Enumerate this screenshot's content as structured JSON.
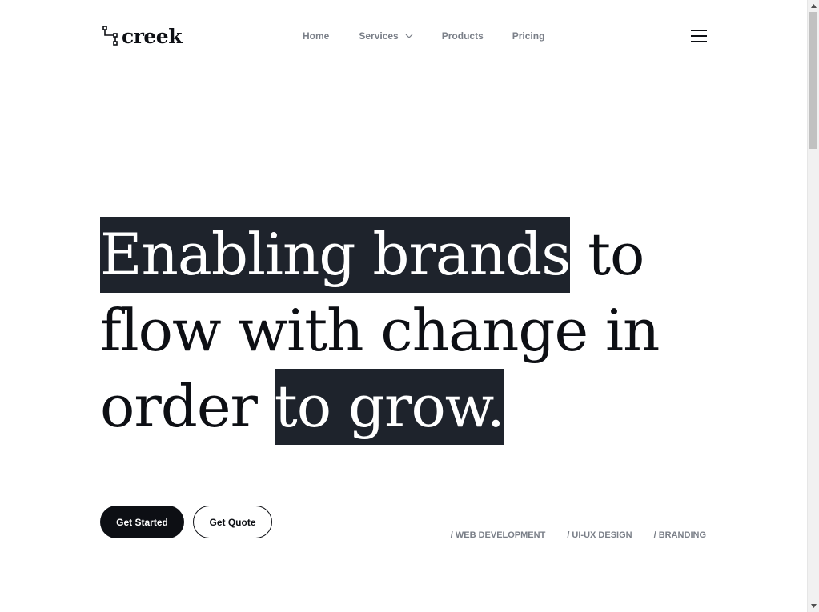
{
  "brand": {
    "name": "creek",
    "icon": "flow-nodes-icon"
  },
  "nav": {
    "items": [
      {
        "label": "Home"
      },
      {
        "label": "Services",
        "has_dropdown": true
      },
      {
        "label": "Products"
      },
      {
        "label": "Pricing"
      }
    ],
    "menu_icon": "hamburger-menu-icon"
  },
  "hero": {
    "line1_highlight": "Enabling brands",
    "line1_rest": " to",
    "line2": "flow with change in",
    "line3_plain": "order ",
    "line3_highlight": "to grow."
  },
  "cta": {
    "primary_label": "Get Started",
    "secondary_label": "Get Quote"
  },
  "tags": [
    "/ WEB DEVELOPMENT",
    "/ UI-UX DESIGN",
    "/ BRANDING"
  ],
  "colors": {
    "text": "#0d0f14",
    "muted": "#7a7f88",
    "highlight_bg": "#1e232c"
  }
}
